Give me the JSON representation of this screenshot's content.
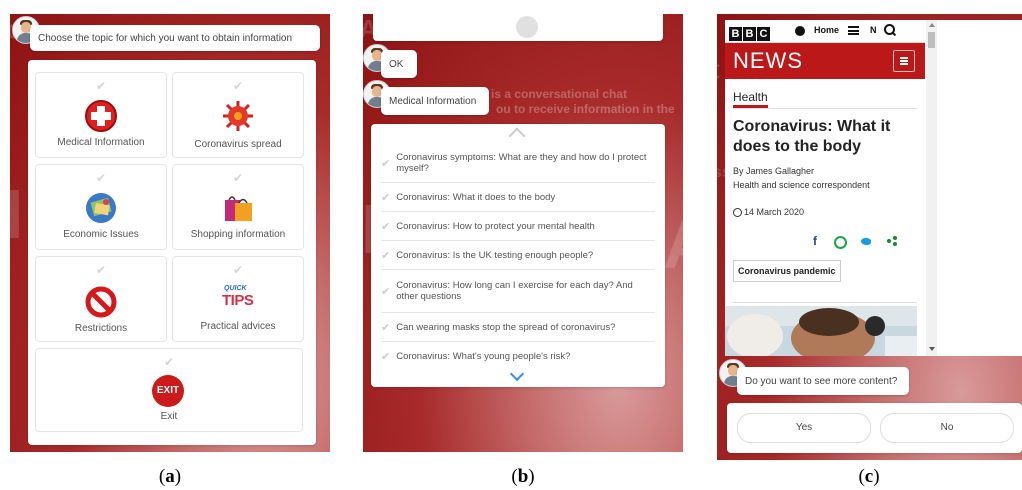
{
  "captions": {
    "a": "a",
    "b": "b",
    "c": "c"
  },
  "panel_a": {
    "prompt": "Choose the topic for which you want to obtain information",
    "topics": [
      {
        "label": "Medical Information",
        "icon": "medical-cross-icon"
      },
      {
        "label": "Coronavirus spread",
        "icon": "virus-icon"
      },
      {
        "label": "Economic Issues",
        "icon": "globe-money-icon"
      },
      {
        "label": "Shopping information",
        "icon": "shopping-bags-icon"
      },
      {
        "label": "Restrictions",
        "icon": "prohibited-icon"
      },
      {
        "label": "Practical advices",
        "icon": "quick-tips-icon"
      },
      {
        "label": "Exit",
        "icon": "exit-icon"
      }
    ],
    "exit_icon_text": "EXIT",
    "tips_icon_top": "QUICK",
    "tips_icon_bottom": "TIPS"
  },
  "panel_b": {
    "user_reply_1": "OK",
    "user_reply_2": "Medical Information",
    "ghost_text_1": "is a conversational chat",
    "ghost_text_2": "ou to receive information in the",
    "items": [
      "Coronavirus symptoms: What are they and how do I protect myself?",
      "Coronavirus: What it does to the body",
      "Coronavirus: How to protect your mental health",
      "Coronavirus: Is the UK testing enough people?",
      "Coronavirus: How long can I exercise for each day? And other questions",
      "Can wearing masks stop the spread of coronavirus?",
      "Coronavirus: What's young people's risk?"
    ]
  },
  "panel_c": {
    "bbc_letters": [
      "B",
      "B",
      "C"
    ],
    "nav_home": "Home",
    "nav_more": "N",
    "brand": "NEWS",
    "section": "Health",
    "headline": "Coronavirus: What it does to the body",
    "byline": "By James Gallagher",
    "role": "Health and science correspondent",
    "date": "14 March 2020",
    "tag": "Coronavirus pandemic",
    "question": "Do you want to see more content?",
    "yes": "Yes",
    "no": "No",
    "brand_color": "#bb1919"
  }
}
